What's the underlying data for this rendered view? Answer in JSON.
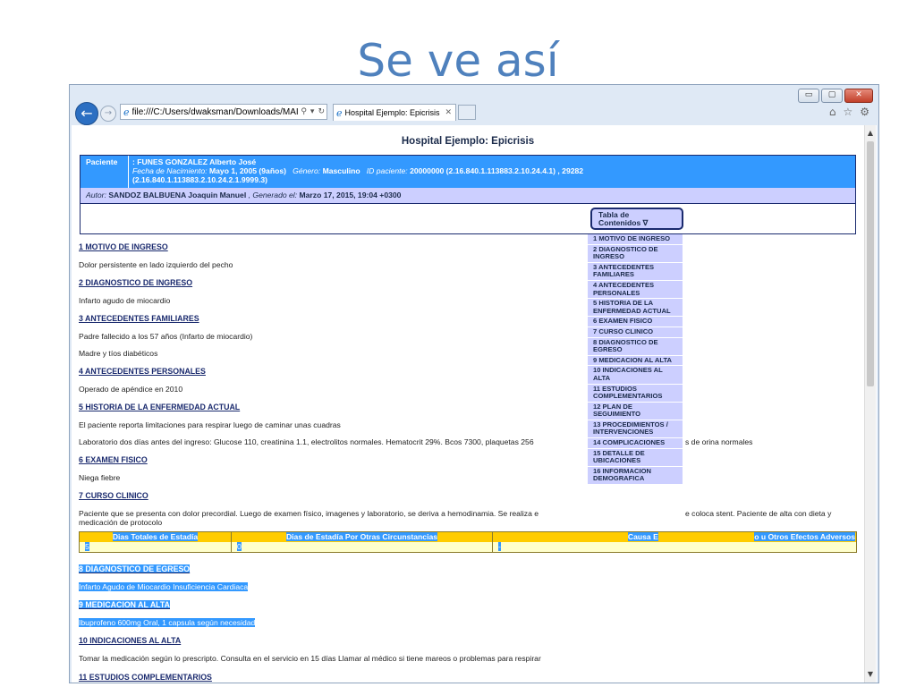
{
  "slide": {
    "title": "Se ve así"
  },
  "browser": {
    "address": "file:///C:/Users/dwaksman/Downloads/MAIS/AF",
    "tab_title": "Hospital Ejemplo: Epicrisis",
    "controls": {
      "minimize": "▭",
      "maximize": "▢",
      "close": "✕"
    },
    "icons": [
      "home-icon",
      "favorites-star-icon",
      "settings-gear-icon"
    ]
  },
  "document": {
    "title": "Hospital Ejemplo: Epicrisis",
    "patient": {
      "label": "Paciente",
      "name": ": FUNES GONZALEZ Alberto José",
      "birth_label": "Fecha de Nacimiento:",
      "birth_value": "Mayo 1, 2005 (9años)",
      "gender_label": "Género:",
      "gender_value": "Masculino",
      "id_label": "ID paciente:",
      "id_value": "20000000 (2.16.840.1.113883.2.10.24.4.1) , 29282",
      "id_value_2": "(2.16.840.1.113883.2.10.24.2.1.9999.3)"
    },
    "author": {
      "label": "Autor:",
      "name": "SANDOZ BALBUENA Joaquin Manuel",
      "generated_label": ", Generado el:",
      "generated_value": "Marzo 17, 2015, 19:04 +0300"
    },
    "toc": {
      "button_label_1": "Tabla de",
      "button_label_2": "Contenidos ∇",
      "items": [
        "1 MOTIVO DE INGRESO",
        "2 DIAGNOSTICO DE INGRESO",
        "3 ANTECEDENTES FAMILIARES",
        "4 ANTECEDENTES PERSONALES",
        "5 HISTORIA DE LA ENFERMEDAD ACTUAL",
        "6 EXAMEN FISICO",
        "7 CURSO CLINICO",
        "8 DIAGNOSTICO DE EGRESO",
        "9 MEDICACION AL ALTA",
        "10 INDICACIONES AL ALTA",
        "11 ESTUDIOS COMPLEMENTARIOS",
        "12 PLAN DE SEGUIMIENTO",
        "13 PROCEDIMIENTOS / INTERVENCIONES",
        "14 COMPLICACIONES",
        "15 DETALLE DE UBICACIONES",
        "16 INFORMACION DEMOGRAFICA"
      ]
    },
    "sections": {
      "s1": {
        "heading": "1 MOTIVO DE INGRESO",
        "text": "Dolor persistente en lado izquierdo del pecho"
      },
      "s2": {
        "heading": "2 DIAGNOSTICO DE INGRESO",
        "text": "Infarto agudo de miocardio"
      },
      "s3": {
        "heading": "3 ANTECEDENTES FAMILIARES",
        "text1": "Padre fallecido a los 57 años (Infarto de miocardio)",
        "text2": "Madre y tíos diabéticos"
      },
      "s4": {
        "heading": "4 ANTECEDENTES PERSONALES",
        "text": "Operado de apéndice en 2010"
      },
      "s5": {
        "heading": "5 HISTORIA DE LA ENFERMEDAD ACTUAL",
        "text1": "El paciente reporta limitaciones para respirar luego de caminar unas cuadras",
        "text2a": "Laboratorio dos días antes del ingreso: Glucose 110, creatinina 1.1, electrolitos normales. Hematocrit 29%. Bcos 7300, plaquetas 256",
        "text2b": "s de orina normales"
      },
      "s6": {
        "heading": "6 EXAMEN FISICO",
        "text": "Niega fiebre"
      },
      "s7": {
        "heading": "7 CURSO CLINICO",
        "text_a": "Paciente que se presenta con dolor precordial. Luego de examen físico, imagenes y laboratorio, se deriva a hemodinamia. Se realiza e",
        "text_b": "e coloca stent. Paciente de alta con dieta y",
        "text_c": "medicación de protocolo"
      },
      "s8": {
        "heading": "8 DIAGNOSTICO DE EGRESO",
        "text": "Infarto Agudo de Miocardio Insuficiencia Cardiaca"
      },
      "s9": {
        "heading": "9 MEDICACION AL ALTA",
        "text": "Ibuprofeno 600mg Oral, 1 capsula según necesidad"
      },
      "s10": {
        "heading": "10 INDICACIONES AL ALTA",
        "text": "Tomar la medicación según lo prescripto. Consulta en el servicio en 15 días Llamar al médico si tiene mareos o problemas para respirar"
      },
      "s11": {
        "heading": "11 ESTUDIOS COMPLEMENTARIOS"
      }
    },
    "stay_table": {
      "col1": {
        "header": "Dias Totales de Estadía",
        "value": "5"
      },
      "col2": {
        "header": "Dias de Estadía Por Otras Circunstancias",
        "value": "0"
      },
      "col3": {
        "header": "Causa E",
        "header_tail": "o u Otros Efectos Adversos",
        "value": "-"
      }
    }
  }
}
